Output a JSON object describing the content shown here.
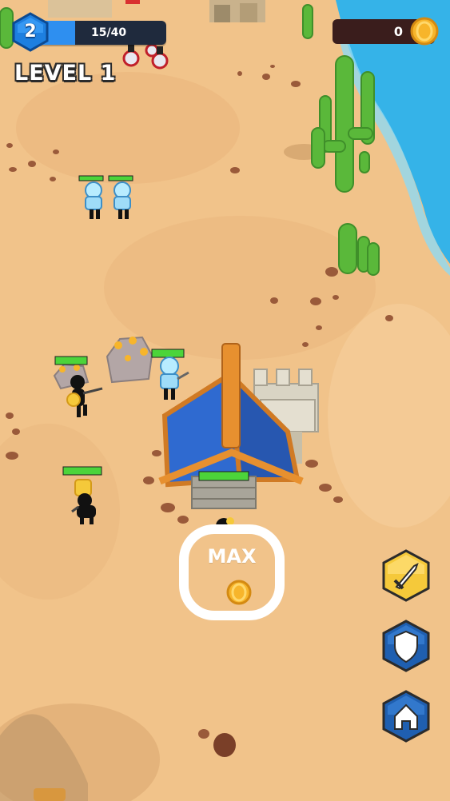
{
  "hud": {
    "player_level": "2",
    "xp_text": "15/40",
    "xp_progress": 0.375,
    "level_label": "LEVEL 1",
    "coins": "0"
  },
  "build_zone": {
    "label": "MAX"
  },
  "actions": [
    {
      "name": "attack-button",
      "icon": "sword-icon",
      "color": "#f5c93a"
    },
    {
      "name": "defend-button",
      "icon": "shield-icon",
      "color": "#1f5fb0"
    },
    {
      "name": "home-button",
      "icon": "house-icon",
      "color": "#1f5fb0"
    }
  ],
  "colors": {
    "sand": "#f1c38a",
    "water": "#35b3e8",
    "xp_fill": "#2e8ff0",
    "hud_dark": "#1f2a3d",
    "coin_gold": "#f7b52b",
    "health_green": "#4cd43a"
  }
}
